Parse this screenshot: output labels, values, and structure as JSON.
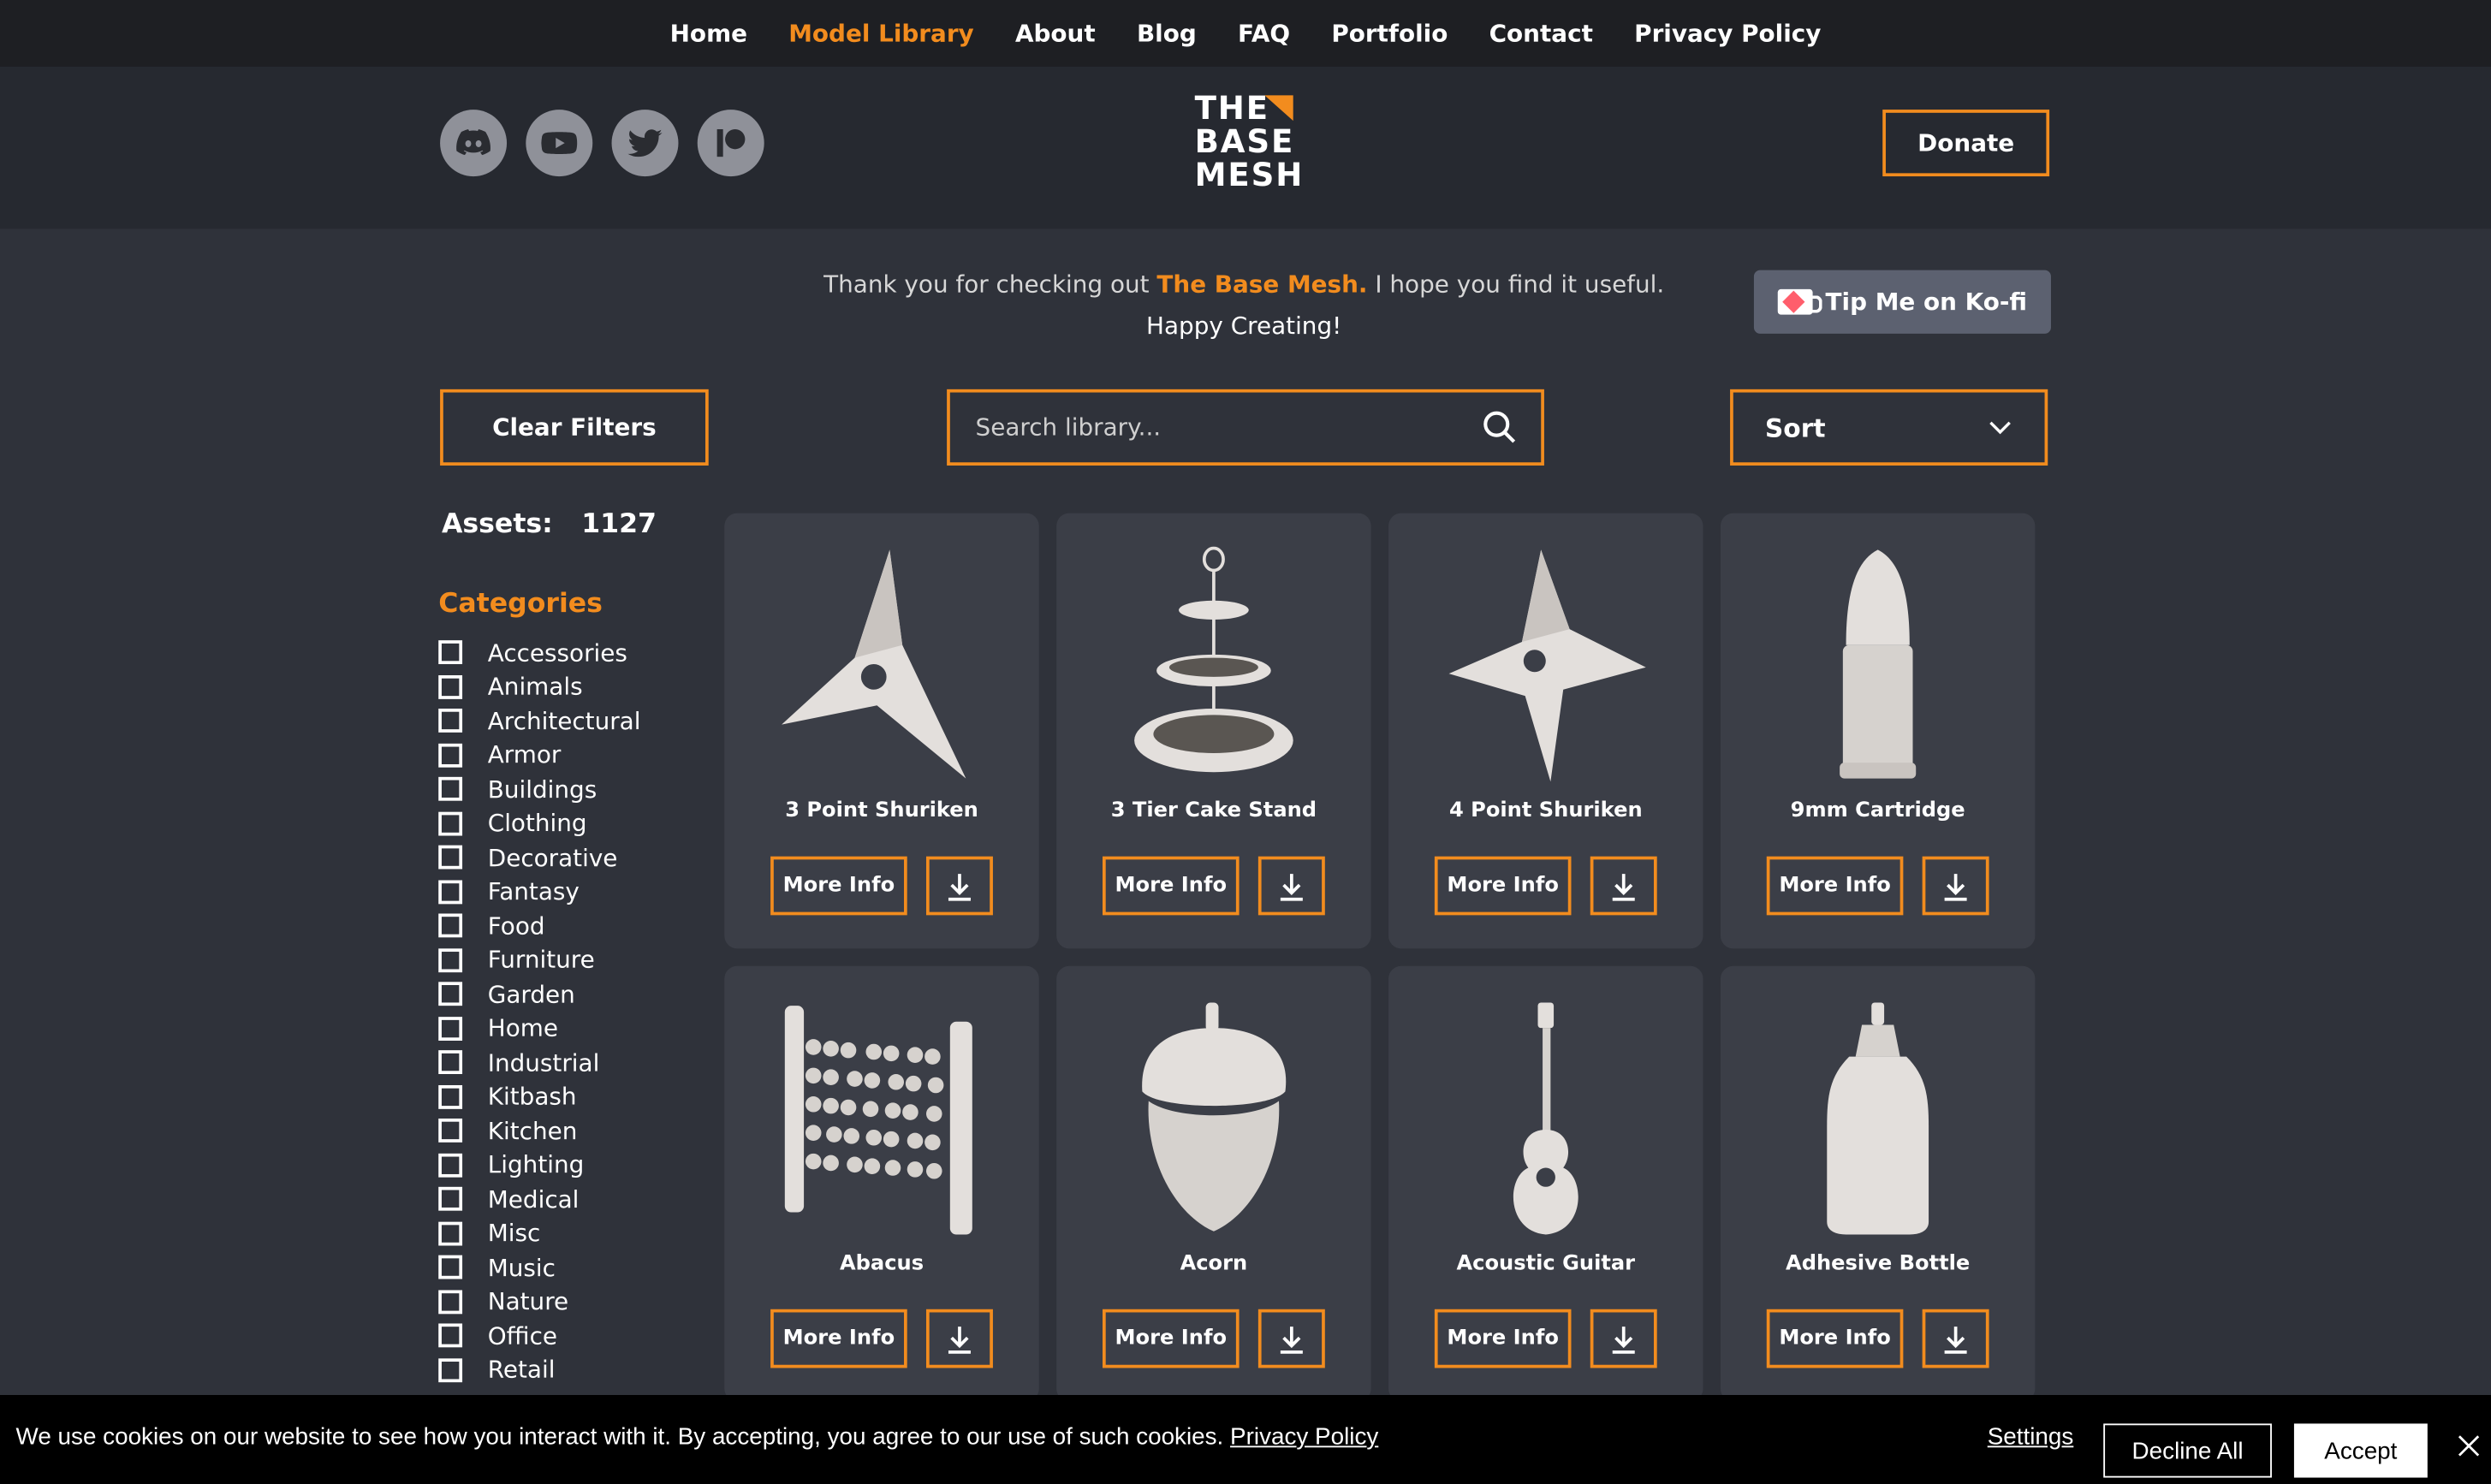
{
  "nav": {
    "items": [
      {
        "label": "Home",
        "active": false
      },
      {
        "label": "Model Library",
        "active": true
      },
      {
        "label": "About",
        "active": false
      },
      {
        "label": "Blog",
        "active": false
      },
      {
        "label": "FAQ",
        "active": false
      },
      {
        "label": "Portfolio",
        "active": false
      },
      {
        "label": "Contact",
        "active": false
      },
      {
        "label": "Privacy Policy",
        "active": false
      }
    ]
  },
  "header": {
    "socials": [
      "discord-icon",
      "youtube-icon",
      "twitter-icon",
      "patreon-icon"
    ],
    "logo": {
      "line1": "THE",
      "line2": "BASE",
      "line3": "MESH"
    },
    "donate_label": "Donate"
  },
  "intro": {
    "prefix": "Thank you for checking out ",
    "brand": "The Base Mesh.",
    "suffix": " I hope you find it useful.",
    "line2": "Happy Creating!",
    "kofi_label": "Tip Me on Ko-fi"
  },
  "filters": {
    "clear_label": "Clear Filters",
    "search_placeholder": "Search library...",
    "sort_label": "Sort"
  },
  "assets": {
    "label": "Assets:",
    "count": "1127"
  },
  "categories": {
    "title": "Categories",
    "items": [
      "Accessories",
      "Animals",
      "Architectural",
      "Armor",
      "Buildings",
      "Clothing",
      "Decorative",
      "Fantasy",
      "Food",
      "Furniture",
      "Garden",
      "Home",
      "Industrial",
      "Kitbash",
      "Kitchen",
      "Lighting",
      "Medical",
      "Misc",
      "Music",
      "Nature",
      "Office",
      "Retail"
    ]
  },
  "cards": [
    {
      "title": "3 Point Shuriken",
      "icon": "shuriken-3-icon"
    },
    {
      "title": "3 Tier Cake Stand",
      "icon": "cake-stand-icon"
    },
    {
      "title": "4 Point Shuriken",
      "icon": "shuriken-4-icon"
    },
    {
      "title": "9mm Cartridge",
      "icon": "cartridge-icon"
    },
    {
      "title": "Abacus",
      "icon": "abacus-icon"
    },
    {
      "title": "Acorn",
      "icon": "acorn-icon"
    },
    {
      "title": "Acoustic Guitar",
      "icon": "guitar-icon"
    },
    {
      "title": "Adhesive Bottle",
      "icon": "bottle-icon"
    }
  ],
  "card_buttons": {
    "more_info": "More Info"
  },
  "cookie": {
    "message": "We use cookies on our website to see how you interact with it. By accepting, you agree to our use of such cookies. ",
    "policy_link": "Privacy Policy",
    "settings": "Settings",
    "decline": "Decline All",
    "accept": "Accept"
  },
  "colors": {
    "accent": "#f28c1e",
    "background": "#2f323a",
    "card": "#3b3e47"
  }
}
